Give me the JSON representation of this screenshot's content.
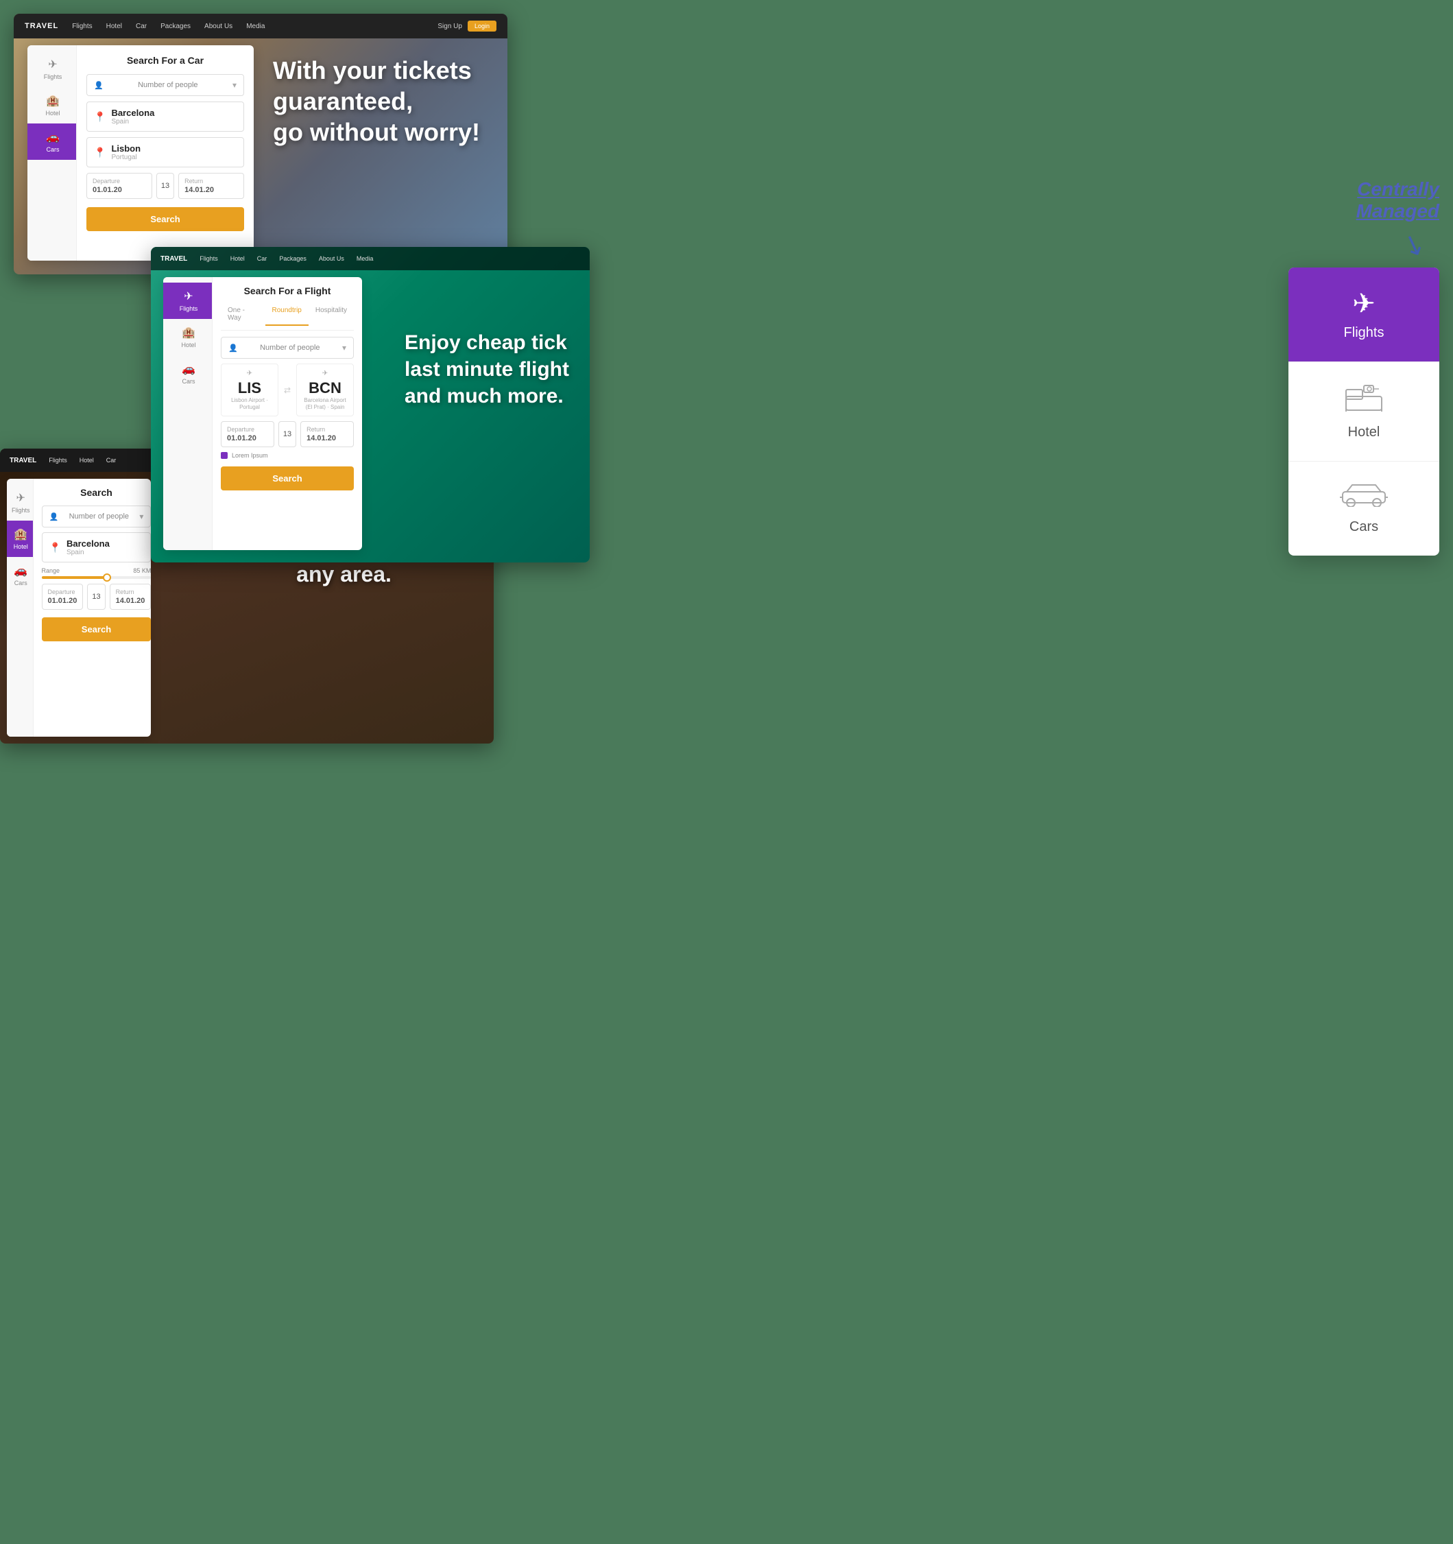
{
  "app": {
    "brand": "TRAVEL",
    "nav_links": [
      "Flights",
      "Hotel",
      "Car",
      "Packages",
      "About Us",
      "Media"
    ],
    "signup_label": "Sign Up",
    "login_label": "Login"
  },
  "card_car": {
    "hero_text": "With your tickets guaranteed,\ngo without worry!",
    "form_title": "Search For a Car",
    "num_people_placeholder": "Number of people",
    "route1_city": "Barcelona",
    "route1_country": "Spain",
    "route2_city": "Lisbon",
    "route2_country": "Portugal",
    "departure_label": "Departure",
    "departure_date": "01.01.20",
    "passengers_count": "13",
    "return_label": "Return",
    "return_date": "14.01.20",
    "search_label": "Search"
  },
  "card_flight": {
    "form_title": "Search For a Flight",
    "tabs": [
      "One - Way",
      "Roundtrip",
      "Hospitality"
    ],
    "active_tab": "Roundtrip",
    "num_people_placeholder": "Number of people",
    "from_iata": "LIS",
    "from_airport": "Lisbon Airport · Portugal",
    "to_iata": "BCN",
    "to_airport": "Barcelona Airport (El Prat) · Spain",
    "departure_label": "Departure",
    "departure_date": "01.01.20",
    "passengers_count": "13",
    "return_label": "Return",
    "return_date": "14.01.20",
    "checkbox_label": "Lorem Ipsum",
    "search_label": "Search",
    "hero_text": "Enjoy cheap tick\nlast minute flight\nand much more."
  },
  "card_hotel": {
    "form_title": "Search",
    "num_people_placeholder": "Number of people",
    "city": "Barcelona",
    "country": "Spain",
    "range_label": "Range",
    "range_value": "85 KM",
    "departure_label": "Departure",
    "departure_date": "01.01.20",
    "passengers_count": "13",
    "return_label": "Return",
    "return_date": "14.01.20",
    "search_label": "Search",
    "hero_text": "Search and book\nhotels in\nany area."
  },
  "right_panel": {
    "centrally_label": "Centrally Managed",
    "categories": [
      {
        "id": "flights",
        "label": "Flights",
        "icon": "✈",
        "active": true
      },
      {
        "id": "hotel",
        "label": "Hotel",
        "icon": "🏨",
        "active": false
      },
      {
        "id": "cars",
        "label": "Cars",
        "icon": "🚗",
        "active": false
      }
    ]
  }
}
